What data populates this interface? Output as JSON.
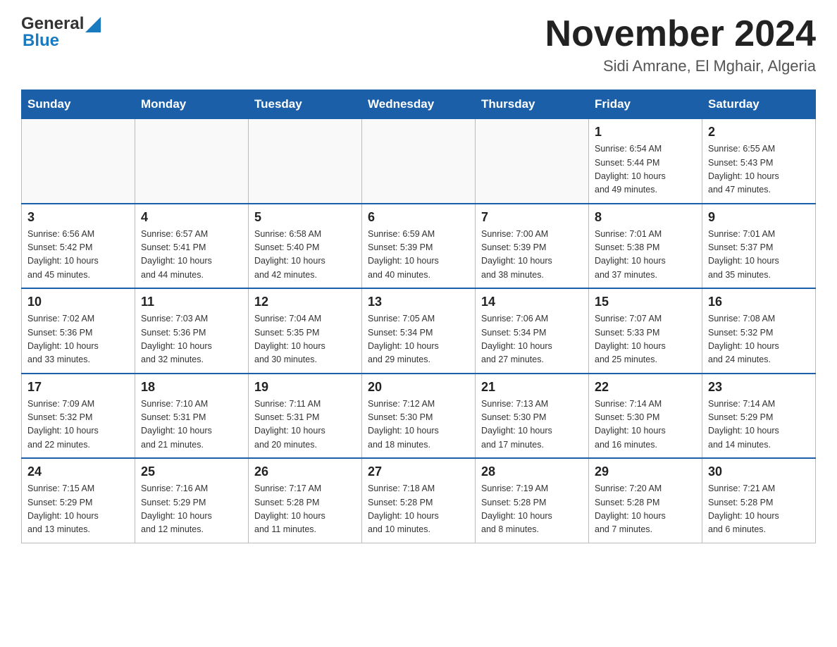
{
  "header": {
    "logo_general": "General",
    "logo_blue": "Blue",
    "month_title": "November 2024",
    "location": "Sidi Amrane, El Mghair, Algeria"
  },
  "weekdays": [
    "Sunday",
    "Monday",
    "Tuesday",
    "Wednesday",
    "Thursday",
    "Friday",
    "Saturday"
  ],
  "weeks": [
    [
      {
        "day": "",
        "info": ""
      },
      {
        "day": "",
        "info": ""
      },
      {
        "day": "",
        "info": ""
      },
      {
        "day": "",
        "info": ""
      },
      {
        "day": "",
        "info": ""
      },
      {
        "day": "1",
        "info": "Sunrise: 6:54 AM\nSunset: 5:44 PM\nDaylight: 10 hours\nand 49 minutes."
      },
      {
        "day": "2",
        "info": "Sunrise: 6:55 AM\nSunset: 5:43 PM\nDaylight: 10 hours\nand 47 minutes."
      }
    ],
    [
      {
        "day": "3",
        "info": "Sunrise: 6:56 AM\nSunset: 5:42 PM\nDaylight: 10 hours\nand 45 minutes."
      },
      {
        "day": "4",
        "info": "Sunrise: 6:57 AM\nSunset: 5:41 PM\nDaylight: 10 hours\nand 44 minutes."
      },
      {
        "day": "5",
        "info": "Sunrise: 6:58 AM\nSunset: 5:40 PM\nDaylight: 10 hours\nand 42 minutes."
      },
      {
        "day": "6",
        "info": "Sunrise: 6:59 AM\nSunset: 5:39 PM\nDaylight: 10 hours\nand 40 minutes."
      },
      {
        "day": "7",
        "info": "Sunrise: 7:00 AM\nSunset: 5:39 PM\nDaylight: 10 hours\nand 38 minutes."
      },
      {
        "day": "8",
        "info": "Sunrise: 7:01 AM\nSunset: 5:38 PM\nDaylight: 10 hours\nand 37 minutes."
      },
      {
        "day": "9",
        "info": "Sunrise: 7:01 AM\nSunset: 5:37 PM\nDaylight: 10 hours\nand 35 minutes."
      }
    ],
    [
      {
        "day": "10",
        "info": "Sunrise: 7:02 AM\nSunset: 5:36 PM\nDaylight: 10 hours\nand 33 minutes."
      },
      {
        "day": "11",
        "info": "Sunrise: 7:03 AM\nSunset: 5:36 PM\nDaylight: 10 hours\nand 32 minutes."
      },
      {
        "day": "12",
        "info": "Sunrise: 7:04 AM\nSunset: 5:35 PM\nDaylight: 10 hours\nand 30 minutes."
      },
      {
        "day": "13",
        "info": "Sunrise: 7:05 AM\nSunset: 5:34 PM\nDaylight: 10 hours\nand 29 minutes."
      },
      {
        "day": "14",
        "info": "Sunrise: 7:06 AM\nSunset: 5:34 PM\nDaylight: 10 hours\nand 27 minutes."
      },
      {
        "day": "15",
        "info": "Sunrise: 7:07 AM\nSunset: 5:33 PM\nDaylight: 10 hours\nand 25 minutes."
      },
      {
        "day": "16",
        "info": "Sunrise: 7:08 AM\nSunset: 5:32 PM\nDaylight: 10 hours\nand 24 minutes."
      }
    ],
    [
      {
        "day": "17",
        "info": "Sunrise: 7:09 AM\nSunset: 5:32 PM\nDaylight: 10 hours\nand 22 minutes."
      },
      {
        "day": "18",
        "info": "Sunrise: 7:10 AM\nSunset: 5:31 PM\nDaylight: 10 hours\nand 21 minutes."
      },
      {
        "day": "19",
        "info": "Sunrise: 7:11 AM\nSunset: 5:31 PM\nDaylight: 10 hours\nand 20 minutes."
      },
      {
        "day": "20",
        "info": "Sunrise: 7:12 AM\nSunset: 5:30 PM\nDaylight: 10 hours\nand 18 minutes."
      },
      {
        "day": "21",
        "info": "Sunrise: 7:13 AM\nSunset: 5:30 PM\nDaylight: 10 hours\nand 17 minutes."
      },
      {
        "day": "22",
        "info": "Sunrise: 7:14 AM\nSunset: 5:30 PM\nDaylight: 10 hours\nand 16 minutes."
      },
      {
        "day": "23",
        "info": "Sunrise: 7:14 AM\nSunset: 5:29 PM\nDaylight: 10 hours\nand 14 minutes."
      }
    ],
    [
      {
        "day": "24",
        "info": "Sunrise: 7:15 AM\nSunset: 5:29 PM\nDaylight: 10 hours\nand 13 minutes."
      },
      {
        "day": "25",
        "info": "Sunrise: 7:16 AM\nSunset: 5:29 PM\nDaylight: 10 hours\nand 12 minutes."
      },
      {
        "day": "26",
        "info": "Sunrise: 7:17 AM\nSunset: 5:28 PM\nDaylight: 10 hours\nand 11 minutes."
      },
      {
        "day": "27",
        "info": "Sunrise: 7:18 AM\nSunset: 5:28 PM\nDaylight: 10 hours\nand 10 minutes."
      },
      {
        "day": "28",
        "info": "Sunrise: 7:19 AM\nSunset: 5:28 PM\nDaylight: 10 hours\nand 8 minutes."
      },
      {
        "day": "29",
        "info": "Sunrise: 7:20 AM\nSunset: 5:28 PM\nDaylight: 10 hours\nand 7 minutes."
      },
      {
        "day": "30",
        "info": "Sunrise: 7:21 AM\nSunset: 5:28 PM\nDaylight: 10 hours\nand 6 minutes."
      }
    ]
  ]
}
